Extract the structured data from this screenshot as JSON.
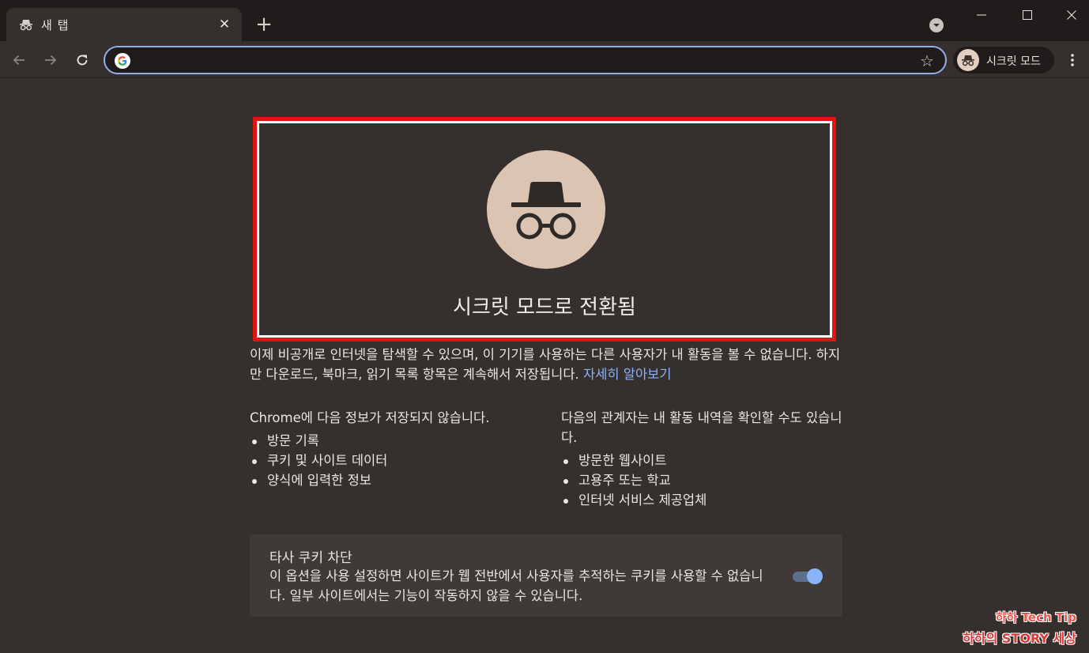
{
  "tab": {
    "title": "새 탭",
    "close_glyph": "✕",
    "icon": "incognito-icon"
  },
  "new_tab_glyph": "+",
  "window_controls": {
    "minimize": "—",
    "maximize": "☐",
    "close": "✕"
  },
  "toolbar": {
    "omnibox_value": "",
    "star_glyph": "☆",
    "profile_label": "시크릿 모드"
  },
  "hero": {
    "title": "시크릿 모드로 전환됨"
  },
  "intro": {
    "text": "이제 비공개로 인터넷을 탐색할 수 있으며, 이 기기를 사용하는 다른 사용자가 내 활동을 볼 수 없습니다. 하지만 다운로드, 북마크, 읽기 목록 항목은 계속해서 저장됩니다. ",
    "link": "자세히 알아보기"
  },
  "left_column": {
    "heading_brand": "Chrome",
    "heading_rest": "에 다음 정보가 저장되지 않습니다.",
    "items": [
      "방문 기록",
      "쿠키 및 사이트 데이터",
      "양식에 입력한 정보"
    ]
  },
  "right_column": {
    "heading": "다음의 관계자는 내 활동 내역을 확인할 수도 있습니다.",
    "items": [
      "방문한 웹사이트",
      "고용주 또는 학교",
      "인터넷 서비스 제공업체"
    ]
  },
  "cookie_card": {
    "title": "타사 쿠키 차단",
    "description": "이 옵션을 사용 설정하면 사이트가 웹 전반에서 사용자를 추적하는 쿠키를 사용할 수 없습니다. 일부 사이트에서는 기능이 작동하지 않을 수 있습니다.",
    "toggle_on": true
  },
  "watermark": {
    "line1": "하하 Tech Tip",
    "line2": "하하의 STORY 세상"
  },
  "colors": {
    "accent": "#8ab4f8",
    "highlight_border": "#e41313",
    "background": "#35302e",
    "hero_circle": "#dcc4b3"
  }
}
